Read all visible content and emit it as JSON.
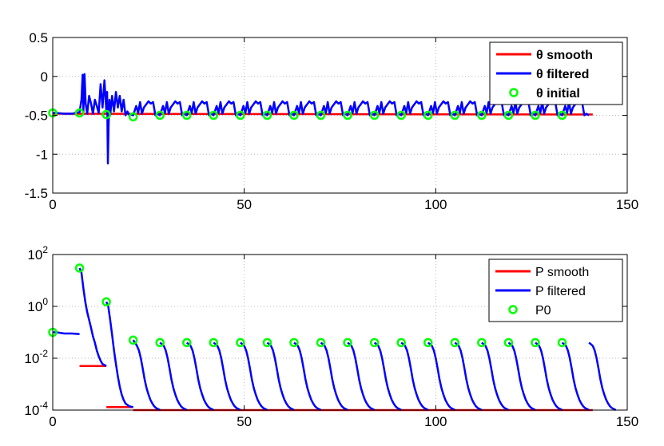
{
  "chart_data": [
    {
      "type": "line",
      "title": "",
      "xlabel": "",
      "ylabel": "",
      "xlim": [
        0,
        150
      ],
      "ylim": [
        -1.5,
        0.5
      ],
      "yscale": "linear",
      "grid": true,
      "legend_position": "top-right",
      "xtick_labels": [
        "0",
        "50",
        "100",
        "150"
      ],
      "ytick_labels": [
        "-1.5",
        "-1",
        "-0.5",
        "0",
        "0.5"
      ],
      "xticks": [
        0,
        50,
        100,
        150
      ],
      "yticks": [
        -1.5,
        -1,
        -0.5,
        0,
        0.5
      ],
      "colors": {
        "smooth": "#ff0000",
        "filtered": "#0000ff",
        "initial": "#00ff00"
      },
      "legend": [
        {
          "key": "smooth",
          "label": "θ smooth"
        },
        {
          "key": "filtered",
          "label": "θ filtered"
        },
        {
          "key": "initial",
          "label": "θ initial"
        }
      ],
      "series": [
        {
          "key": "smooth",
          "x": [
            0,
            141
          ],
          "y": [
            -0.48,
            -0.49
          ]
        },
        {
          "key": "filtered",
          "x": [
            0,
            1,
            3,
            5,
            7,
            7.5,
            7.8,
            8,
            8.3,
            8.6,
            9,
            9.5,
            10,
            10.5,
            11,
            11.5,
            12,
            12.5,
            13,
            13.5,
            14,
            14.2,
            14.4,
            14.6,
            14.8,
            15,
            15.5,
            16,
            16.5,
            17,
            17.5,
            18,
            18.5,
            19,
            19.5,
            20,
            20.5,
            21
          ],
          "y": [
            -0.47,
            -0.47,
            -0.48,
            -0.48,
            -0.46,
            -0.3,
            0.02,
            -0.45,
            0.03,
            -0.35,
            -0.48,
            -0.25,
            -0.35,
            -0.48,
            -0.3,
            -0.38,
            -0.47,
            -0.1,
            -0.4,
            -0.05,
            -0.45,
            -0.2,
            -1.12,
            -0.6,
            -0.3,
            -0.5,
            -0.25,
            -0.45,
            -0.2,
            -0.4,
            -0.25,
            -0.45,
            -0.3,
            -0.5,
            -0.45,
            -0.5,
            -0.49,
            -0.5
          ]
        },
        {
          "key": "initial",
          "x": [
            0,
            7,
            14,
            21,
            28,
            35,
            42,
            49,
            56,
            63,
            70,
            77,
            84,
            91,
            98,
            105,
            112,
            119,
            126,
            133
          ],
          "y": [
            -0.47,
            -0.47,
            -0.49,
            -0.52,
            -0.5,
            -0.5,
            -0.5,
            -0.5,
            -0.5,
            -0.5,
            -0.5,
            -0.5,
            -0.5,
            -0.5,
            -0.5,
            -0.5,
            -0.5,
            -0.5,
            -0.5,
            -0.5
          ]
        }
      ],
      "periodic_filtered": {
        "start": 21,
        "period": 7,
        "count": 17,
        "cycle_offsets": [
          0,
          0.8,
          1.3,
          1.8,
          2.3,
          2.8,
          3.4,
          4.0,
          4.6,
          5.2,
          5.8,
          6.3,
          7.0
        ],
        "cycle_values": [
          -0.5,
          -0.38,
          -0.47,
          -0.33,
          -0.48,
          -0.4,
          -0.36,
          -0.32,
          -0.35,
          -0.33,
          -0.5,
          -0.48,
          -0.5
        ]
      }
    },
    {
      "type": "line",
      "title": "",
      "xlabel": "",
      "ylabel": "",
      "xlim": [
        0,
        150
      ],
      "ylim": [
        0.0001,
        100
      ],
      "yscale": "log",
      "grid": true,
      "legend_position": "top-right",
      "xtick_labels": [
        "0",
        "50",
        "100",
        "150"
      ],
      "ytick_labels": [
        {
          "base": "10",
          "exp": "-4"
        },
        {
          "base": "10",
          "exp": "-2"
        },
        {
          "base": "10",
          "exp": "0"
        },
        {
          "base": "10",
          "exp": "2"
        }
      ],
      "xticks": [
        0,
        50,
        100,
        150
      ],
      "yticks": [
        0.0001,
        0.01,
        1,
        100
      ],
      "colors": {
        "smooth": "#ff0000",
        "filtered": "#0000ff",
        "initial": "#00ff00"
      },
      "legend": [
        {
          "key": "smooth",
          "label": "P smooth"
        },
        {
          "key": "filtered",
          "label": "P filtered"
        },
        {
          "key": "initial",
          "label": "P0"
        }
      ],
      "smooth_segments": [
        {
          "x": [
            7,
            14
          ],
          "y": [
            0.005,
            0.005
          ]
        },
        {
          "x": [
            14,
            21
          ],
          "y": [
            0.00013,
            0.00013
          ]
        },
        {
          "x": [
            21,
            141
          ],
          "y": [
            0.0001,
            0.0001
          ]
        }
      ],
      "filtered_segments": [
        {
          "x": [
            0,
            1,
            3,
            5,
            7
          ],
          "y": [
            0.1,
            0.1,
            0.09,
            0.09,
            0.085
          ]
        },
        {
          "x": [
            7,
            7.5,
            8,
            8.5,
            9,
            9.5,
            10,
            10.5,
            11,
            11.5,
            12,
            12.5,
            13,
            14
          ],
          "y": [
            30,
            20,
            5,
            1.5,
            0.6,
            0.3,
            0.15,
            0.07,
            0.04,
            0.02,
            0.012,
            0.008,
            0.006,
            0.005
          ]
        },
        {
          "x": [
            14,
            14.5,
            15,
            15.5,
            16,
            16.5,
            17,
            17.5,
            18,
            18.5,
            19,
            20,
            21
          ],
          "y": [
            1.5,
            1,
            0.3,
            0.08,
            0.02,
            0.006,
            0.002,
            0.0008,
            0.0004,
            0.00025,
            0.00018,
            0.00014,
            0.00013
          ]
        }
      ],
      "periodic_filtered": {
        "start": 21,
        "period": 7,
        "count": 18,
        "cycle_offsets": [
          0,
          0.5,
          1.0,
          1.5,
          2.0,
          2.5,
          3.0,
          3.5,
          4.0,
          4.5,
          5.0,
          5.5,
          6.0,
          6.5,
          7.0
        ],
        "cycle_values_first": [
          0.05,
          0.04,
          0.03,
          0.02,
          0.01,
          0.004,
          0.0015,
          0.0007,
          0.0004,
          0.00025,
          0.00018,
          0.00014,
          0.00012,
          0.00011,
          0.0001
        ],
        "cycle_values": [
          0.04,
          0.035,
          0.03,
          0.02,
          0.01,
          0.004,
          0.0015,
          0.0007,
          0.0004,
          0.00025,
          0.00018,
          0.00014,
          0.00012,
          0.00011,
          0.0001
        ]
      },
      "initial_points": {
        "x": [
          0,
          7,
          14,
          21,
          28,
          35,
          42,
          49,
          56,
          63,
          70,
          77,
          84,
          91,
          98,
          105,
          112,
          119,
          126,
          133
        ],
        "y": [
          0.1,
          30,
          1.5,
          0.05,
          0.04,
          0.04,
          0.04,
          0.04,
          0.04,
          0.04,
          0.04,
          0.04,
          0.04,
          0.04,
          0.04,
          0.04,
          0.04,
          0.04,
          0.04,
          0.04
        ]
      }
    }
  ]
}
